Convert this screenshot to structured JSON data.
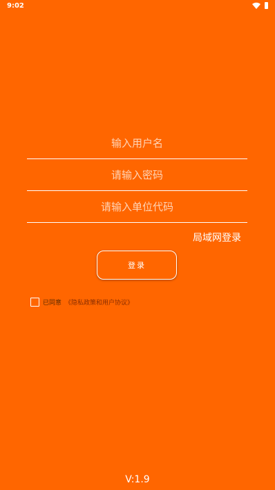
{
  "status_bar": {
    "time": "9:02"
  },
  "form": {
    "username_placeholder": "输入用户名",
    "password_placeholder": "请输入密码",
    "unitcode_placeholder": "请输入单位代码"
  },
  "lan_login_label": "局域网登录",
  "login_button_label": "登录",
  "agreement": {
    "prefix": "已同意",
    "link_text": "《隐私政策和用户协议》"
  },
  "version": "V:1.9",
  "colors": {
    "background": "#FF6600",
    "placeholder": "#FFD3B5"
  }
}
